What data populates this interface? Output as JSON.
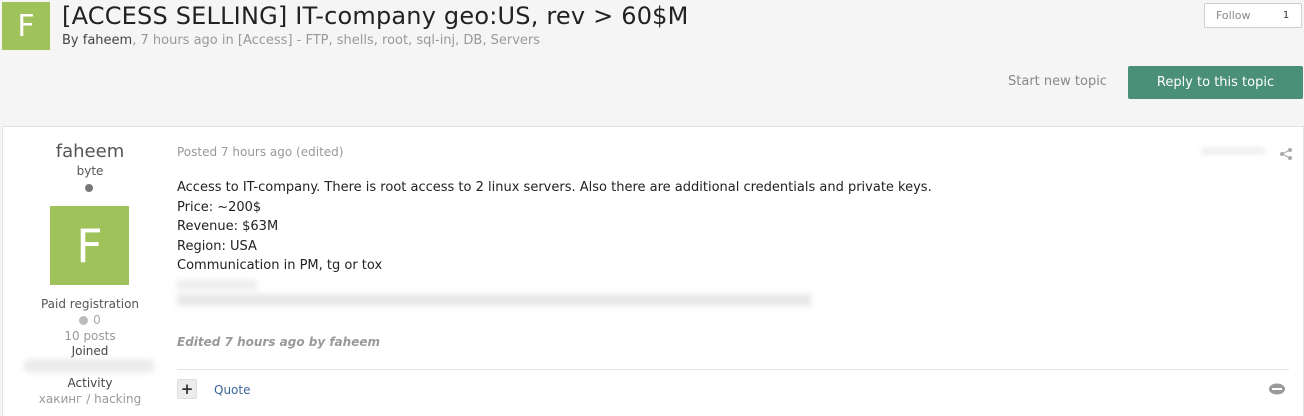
{
  "topic": {
    "avatar_letter": "F",
    "title": "[ACCESS SELLING] IT-company geo:US, rev > 60$M",
    "meta": {
      "by": "By",
      "author": "faheem",
      "time": ", 7 hours ago in",
      "forum": "[Access] - FTP, shells, root, sql-inj, DB, Servers"
    }
  },
  "follow": {
    "label": "Follow",
    "count": "1"
  },
  "actions": {
    "start_topic": "Start new topic",
    "reply": "Reply to this topic"
  },
  "author": {
    "name": "faheem",
    "rank": "byte",
    "avatar_letter": "F",
    "group": "Paid registration",
    "reputation": "0",
    "posts": "10 posts",
    "joined": "Joined",
    "activity": "Activity",
    "interests": "хакинг / hacking"
  },
  "post": {
    "meta": "Posted 7 hours ago (edited)",
    "lines": [
      "Access to IT-company. There is root access to 2 linux servers. Also there are additional credentials and private keys.",
      "Price: ~200$",
      "Revenue: $63M",
      "Region: USA",
      "Communication in PM, tg or tox"
    ],
    "edited": "Edited 7 hours ago by faheem",
    "quote_label": "Quote",
    "plus_label": "+"
  },
  "colors": {
    "avatar": "#9fc25a",
    "reply_button": "#4a8f77",
    "link": "#3d6598"
  },
  "icons": {
    "share": "share-icon",
    "multiquote": "multiquote-icon",
    "status": "offline-status-dot"
  }
}
